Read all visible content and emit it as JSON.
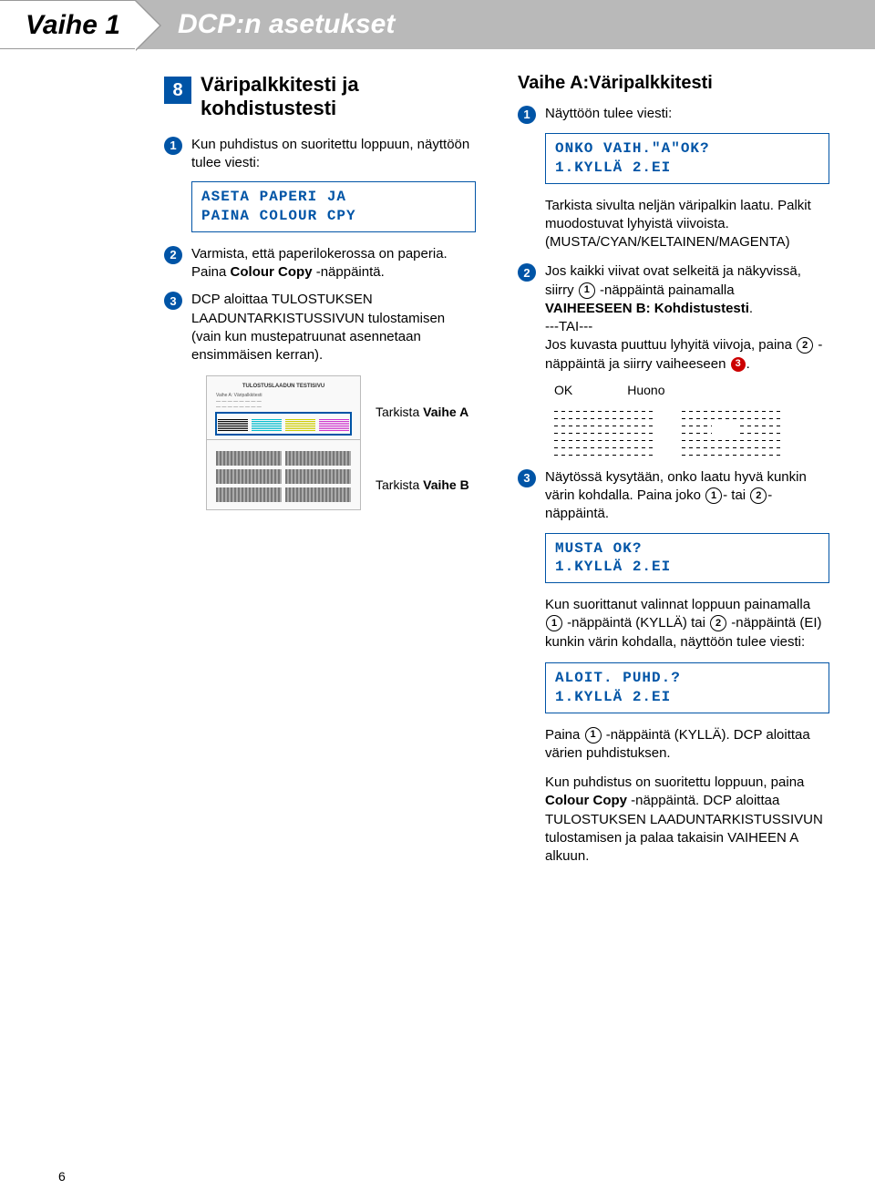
{
  "header": {
    "step": "Vaihe 1",
    "title": "DCP:n asetukset"
  },
  "section8": {
    "num": "8",
    "title": "Väripalkkitesti ja kohdistustesti"
  },
  "left": {
    "i1": "Kun puhdistus on suoritettu loppuun, näyttöön tulee viesti:",
    "lcd1": "ASETA PAPERI JA\nPAINA COLOUR CPY",
    "i2a": "Varmista, että paperilokerossa on paperia.",
    "i2b_pre": "Paina ",
    "i2b_key": "Colour Copy",
    "i2b_post": " -näppäintä.",
    "i3": "DCP aloittaa TULOSTUKSEN LAADUNTARKISTUSSIVUN tulostamisen (vain kun mustepatruunat asennetaan ensimmäisen kerran).",
    "check_a_pre": "Tarkista ",
    "check_a": "Vaihe A",
    "check_b_pre": "Tarkista ",
    "check_b": "Vaihe B",
    "sheet_title": "TULOSTUSLAADUN TESTISIVU"
  },
  "right": {
    "title": "Vaihe A:Väripalkkitesti",
    "i1": "Näyttöön tulee viesti:",
    "lcd1": "ONKO VAIH.\"A\"OK?\n1.KYLLÄ 2.EI",
    "para1": "Tarkista sivulta neljän väripalkin laatu. Palkit muodostuvat lyhyistä viivoista.\n(MUSTA/CYAN/KELTAINEN/MAGENTA)",
    "i2_a": "Jos kaikki viivat ovat selkeitä ja näkyvissä, siirry ",
    "i2_b": " -näppäintä painamalla ",
    "i2_c": "VAIHEESEEN B:  Kohdistustesti",
    "i2_d": "---TAI---",
    "i2_e": "Jos kuvasta puuttuu lyhyitä viivoja, paina ",
    "i2_f": " -näppäintä ja siirry vaiheeseen ",
    "ok": "OK",
    "huono": "Huono",
    "i3_a": "Näytössä kysytään, onko laatu hyvä kunkin värin kohdalla. Paina joko ",
    "i3_b": "- tai ",
    "i3_c": "-näppäintä.",
    "lcd2": "MUSTA OK?\n1.KYLLÄ 2.EI",
    "para2_a": "Kun suorittanut valinnat loppuun painamalla ",
    "para2_b": " -näppäintä (KYLLÄ) tai ",
    "para2_c": " -näppäintä (EI) kunkin värin kohdalla, näyttöön tulee viesti:",
    "lcd3": "ALOIT. PUHD.?\n1.KYLLÄ 2.EI",
    "para3_a": "Paina ",
    "para3_b": " -näppäintä (KYLLÄ). DCP aloittaa värien puhdistuksen.",
    "para4_a": "Kun puhdistus on suoritettu loppuun, paina ",
    "para4_key": "Colour Copy",
    "para4_b": " -näppäintä. DCP aloittaa TULOSTUKSEN LAADUNTARKISTUSSIVUN tulostamisen ja palaa takaisin VAIHEEN A alkuun."
  },
  "keys": {
    "k1": "1",
    "k2": "2"
  },
  "pagenum": "6"
}
